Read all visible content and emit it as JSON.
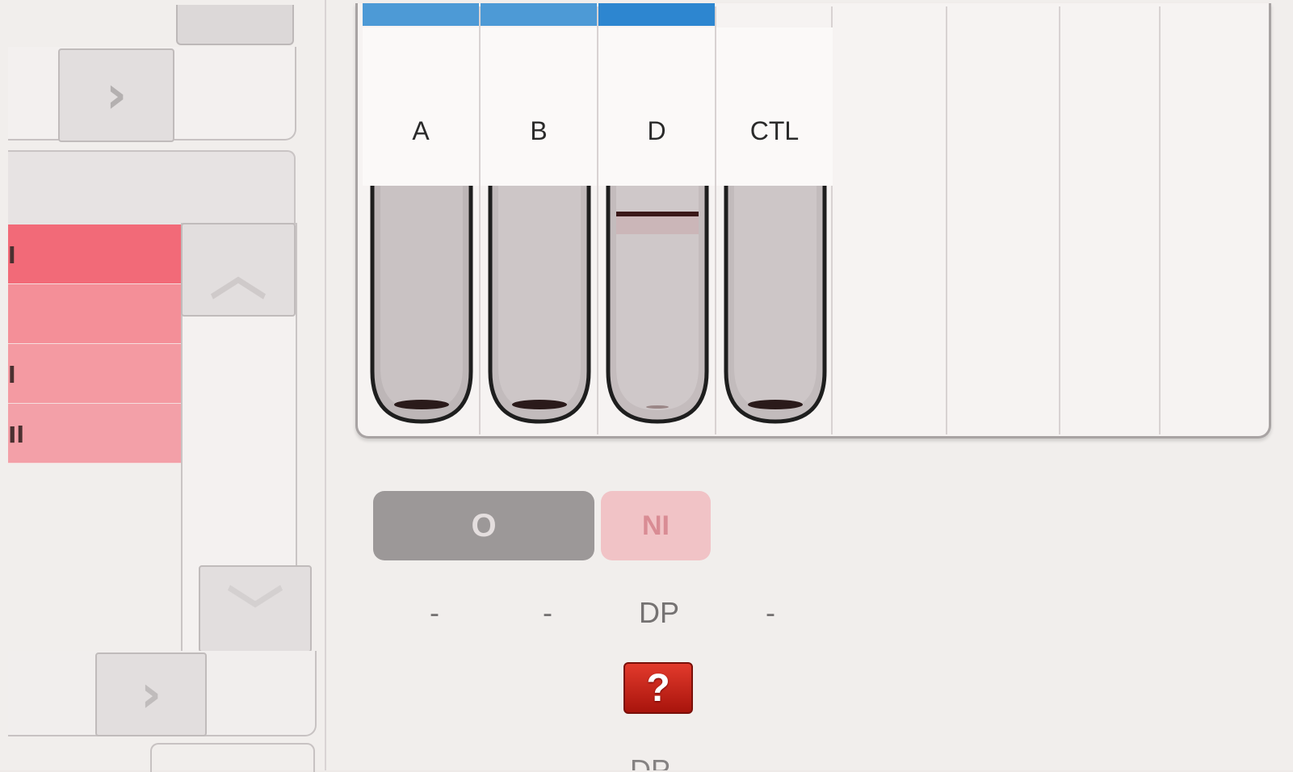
{
  "navigation": {
    "next_symbol": "›",
    "scroll_up_symbol": "︿",
    "scroll_down_symbol": "﹀"
  },
  "left_list": {
    "colors": [
      "#f26a78",
      "#f48f98",
      "#f49aa2",
      "#f3a0a8"
    ],
    "items": [
      {
        "text": "l"
      },
      {
        "text": ""
      },
      {
        "text": "l"
      },
      {
        "text": "Il"
      }
    ]
  },
  "tubes": [
    {
      "label": "A",
      "result": "pellet",
      "bar_color": "#4d9ad6"
    },
    {
      "label": "B",
      "result": "pellet",
      "bar_color": "#4d9ad6"
    },
    {
      "label": "D",
      "result": "agglutination-top",
      "bar_color": "#2d86d0"
    },
    {
      "label": "CTL",
      "result": "pellet",
      "bar_color": "none"
    }
  ],
  "interpretation": {
    "blood_group_button": "O",
    "rh_button": "NI",
    "readings": [
      "-",
      "-",
      "DP",
      "-"
    ],
    "warning_icon": "question-mark-icon",
    "warning_symbol": "?",
    "footer_text_partial": "DP"
  },
  "colors": {
    "accent_blue": "#4d9ad6",
    "accent_blue_dark": "#2d86d0",
    "warning_red": "#d42a1e",
    "button_grey": "#9c9898",
    "button_pink": "#f1c3c6"
  }
}
